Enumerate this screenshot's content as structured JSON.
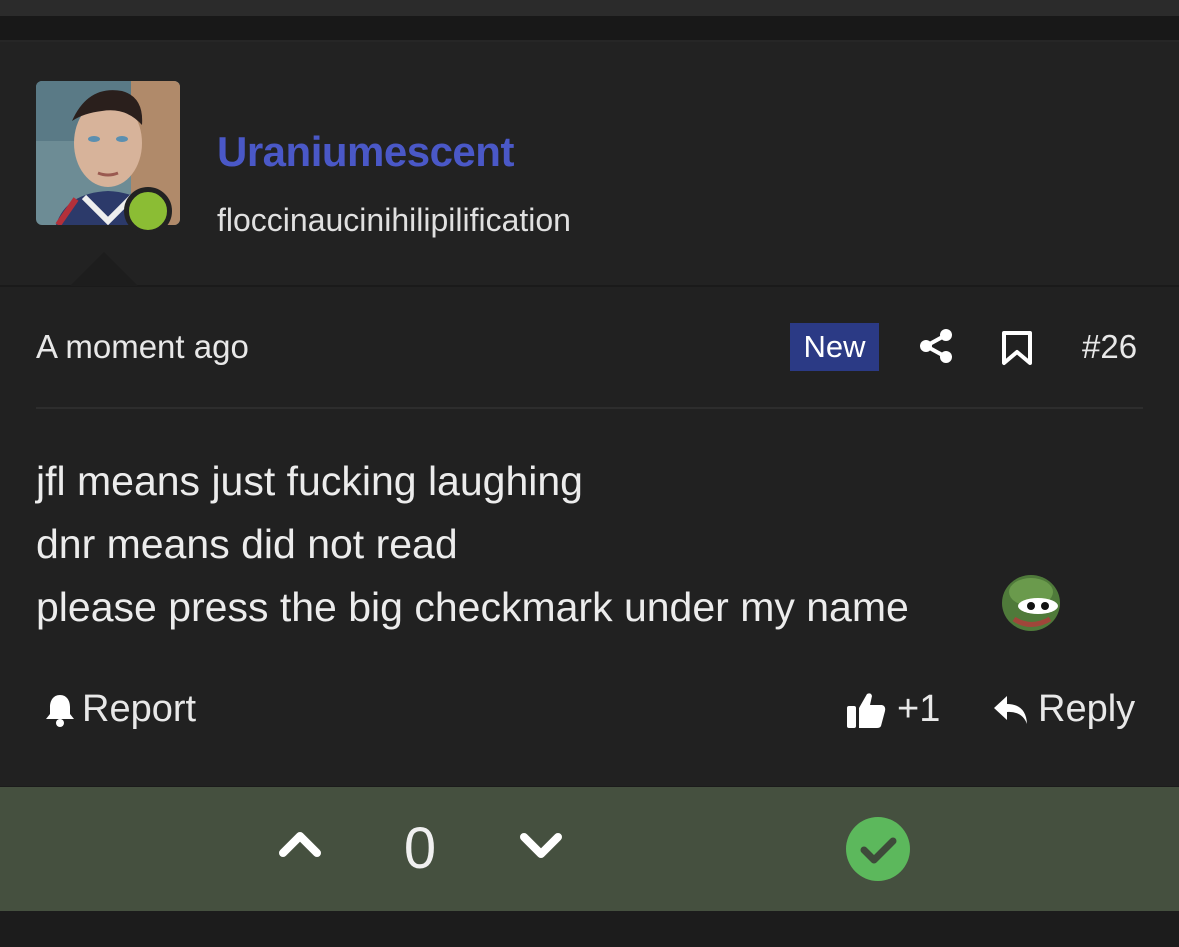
{
  "post": {
    "username": "Uraniumescent",
    "user_title": "floccinaucinihilipilification",
    "time": "A moment ago",
    "badge": "New",
    "post_number": "#26",
    "body_lines": [
      "jfl means just fucking laughing",
      "dnr means did not read",
      "please press the big checkmark under my name"
    ],
    "report_label": "Report",
    "like_count": "+1",
    "reply_label": "Reply"
  },
  "vote": {
    "score": "0"
  },
  "icons": {
    "share": "share-icon",
    "bookmark": "bookmark-icon",
    "bell": "bell-icon",
    "thumbs_up": "thumbs-up-icon",
    "reply": "reply-arrow-icon",
    "upvote": "chevron-up-icon",
    "downvote": "chevron-down-icon",
    "accept": "check-circle-icon",
    "emoji": "pepe-emoji"
  },
  "colors": {
    "username": "#4a58c7",
    "badge_bg": "#2b3a85",
    "online": "#8bbd34",
    "vote_bar": "#45503f",
    "accept": "#5cb85c"
  }
}
